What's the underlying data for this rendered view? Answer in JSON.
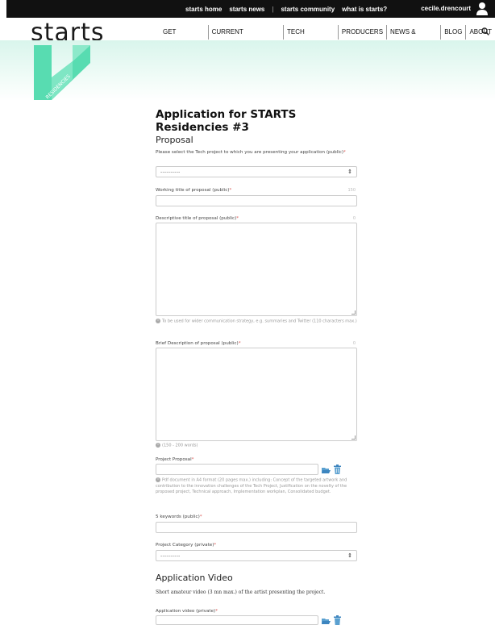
{
  "topbar": {
    "links": [
      "starts home",
      "starts news",
      "|",
      "starts community",
      "what is starts?"
    ],
    "user": "cecile.drencourt",
    "avatar_icon": "user-icon"
  },
  "header": {
    "logo": "starts",
    "nav": [
      "GET INVOLVED",
      "CURRENT RESIDENCIES",
      "TECH PROJECTS",
      "PRODUCERS",
      "NEWS & EVENTS",
      "BLOG",
      "ABOUT"
    ],
    "search_icon": "search-icon"
  },
  "hero": {
    "badge_text": "RESIDENCIES",
    "accent_color": "#58dcb1"
  },
  "form": {
    "title": "Application for STARTS Residencies #3",
    "proposal_heading": "Proposal",
    "tech_project": {
      "label": "Please select the Tech project to which you are presenting your application (public)",
      "required": "*",
      "value": "----------"
    },
    "working_title": {
      "label": "Working title of proposal (public)",
      "required": "*",
      "counter": "150"
    },
    "descriptive_title": {
      "label": "Descriptive title of proposal (public)",
      "required": "*",
      "counter": "0",
      "help": "To be used for wider communication strategy, e.g. summaries and Twitter (110 characters max.)"
    },
    "brief_description": {
      "label": "Brief Description of proposal (public)",
      "required": "*",
      "counter": "0",
      "help": "(150 - 200 words)"
    },
    "project_proposal": {
      "label": "Project Proposal",
      "required": "*",
      "help": "Pdf document in A4 format (20 pages max.) including: Concept of the targeted artwork and contribution to the innovation challenges of the Tech Project, Justification on the novelty of the proposed project, Technical approach, Implementation workplan, Consolidated budget."
    },
    "keywords": {
      "label": "5 keywords (public)",
      "required": "*"
    },
    "project_category": {
      "label": "Project Category (private)",
      "required": "*",
      "value": "----------"
    },
    "video_heading": "Application Video",
    "video_description": "Short amateur video (3 mn max.) of the artist presenting the project.",
    "application_video": {
      "label": "Application video (private)",
      "required": "*"
    }
  }
}
